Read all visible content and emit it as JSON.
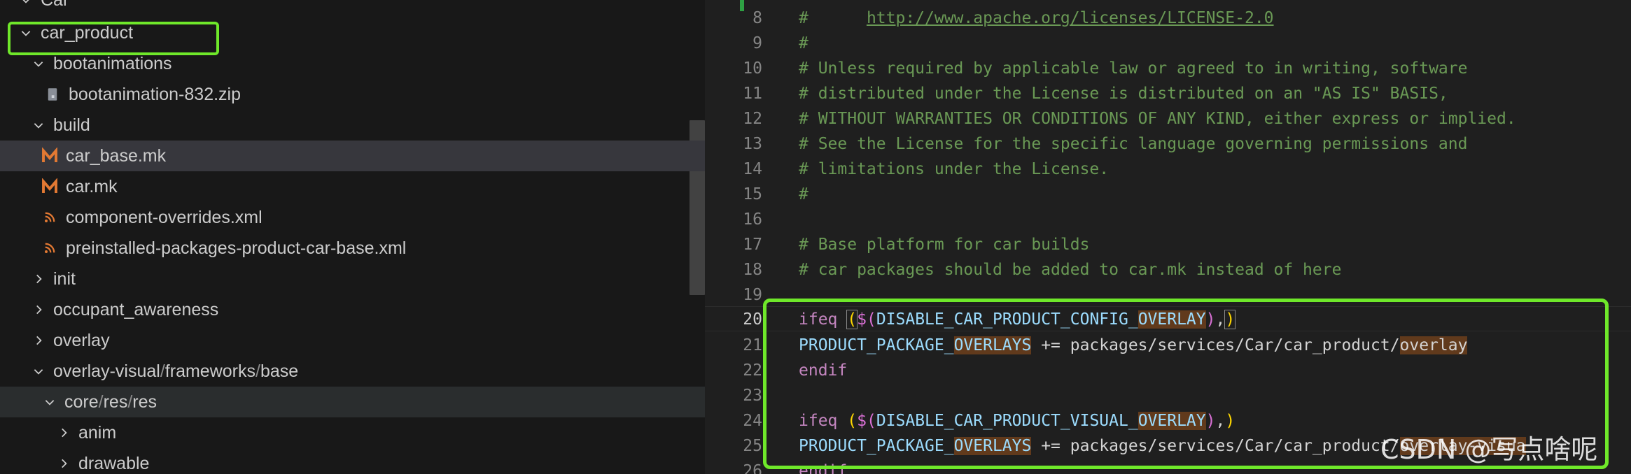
{
  "explorer": {
    "items": [
      {
        "label": "Car",
        "type": "folder-open"
      },
      {
        "label": "car_product",
        "type": "folder-open"
      },
      {
        "label": "bootanimations",
        "type": "folder-open"
      },
      {
        "label": "bootanimation-832.zip",
        "type": "zip-file"
      },
      {
        "label": "build",
        "type": "folder-open"
      },
      {
        "label": "car_base.mk",
        "type": "makefile"
      },
      {
        "label": "car.mk",
        "type": "makefile"
      },
      {
        "label": "component-overrides.xml",
        "type": "rss-file"
      },
      {
        "label": "preinstalled-packages-product-car-base.xml",
        "type": "rss-file"
      },
      {
        "label": "init",
        "type": "folder-closed"
      },
      {
        "label": "occupant_awareness",
        "type": "folder-closed"
      },
      {
        "label": "overlay",
        "type": "folder-closed"
      },
      {
        "label": "overlay-visual",
        "sep": "/",
        "label2": "frameworks",
        "label3": "base",
        "type": "folder-open"
      },
      {
        "label": "core",
        "sep": "/",
        "label2": "res",
        "label3": "res",
        "type": "folder-open"
      },
      {
        "label": "anim",
        "type": "folder-closed"
      },
      {
        "label": "drawable",
        "type": "folder-closed"
      }
    ]
  },
  "editor": {
    "lines": [
      {
        "n": "8",
        "c": "#      ",
        "link": "http://www.apache.org/licenses/LICENSE-2.0"
      },
      {
        "n": "9",
        "c": "#"
      },
      {
        "n": "10",
        "c": "# Unless required by applicable law or agreed to in writing, software"
      },
      {
        "n": "11",
        "c": "# distributed under the License is distributed on an \"AS IS\" BASIS,"
      },
      {
        "n": "12",
        "c": "# WITHOUT WARRANTIES OR CONDITIONS OF ANY KIND, either express or implied."
      },
      {
        "n": "13",
        "c": "# See the License for the specific language governing permissions and"
      },
      {
        "n": "14",
        "c": "# limitations under the License."
      },
      {
        "n": "15",
        "c": "#"
      },
      {
        "n": "16",
        "c": ""
      },
      {
        "n": "17",
        "c": "# Base platform for car builds"
      },
      {
        "n": "18",
        "c": "# car packages should be added to car.mk instead of here"
      },
      {
        "n": "19",
        "c": ""
      },
      {
        "n": "20",
        "kw": "ifeq",
        "sp": " ",
        "open": "(",
        "dollar": "$(",
        "var": "DISABLE_CAR_PRODUCT_CONFIG_",
        "hl": "OVERLAY",
        "close1": ")",
        "comma": ",",
        "close2": ")"
      },
      {
        "n": "21",
        "var": "PRODUCT_PACKAGE_",
        "hl": "OVERLAYS",
        "rest": " += packages/services/Car/car_product/",
        "hl2": "overlay"
      },
      {
        "n": "22",
        "kw": "endif"
      },
      {
        "n": "23",
        "c": ""
      },
      {
        "n": "24",
        "kw": "ifeq",
        "sp": " ",
        "open": "(",
        "dollar": "$(",
        "var": "DISABLE_CAR_PRODUCT_VISUAL_",
        "hl": "OVERLAY",
        "close1": ")",
        "comma": ",",
        "close2": ")"
      },
      {
        "n": "25",
        "var": "PRODUCT_PACKAGE_",
        "hl": "OVERLAYS",
        "rest": " += packages/services/Car/car_product/",
        "hl2": "overlay-visua"
      },
      {
        "n": "26",
        "kw": "endif"
      }
    ]
  },
  "watermark": "CSDN @写点啥呢",
  "colors": {
    "highlight_box": "#6fe82a",
    "makefile_icon": "#e37933",
    "rss_icon": "#e37933"
  }
}
